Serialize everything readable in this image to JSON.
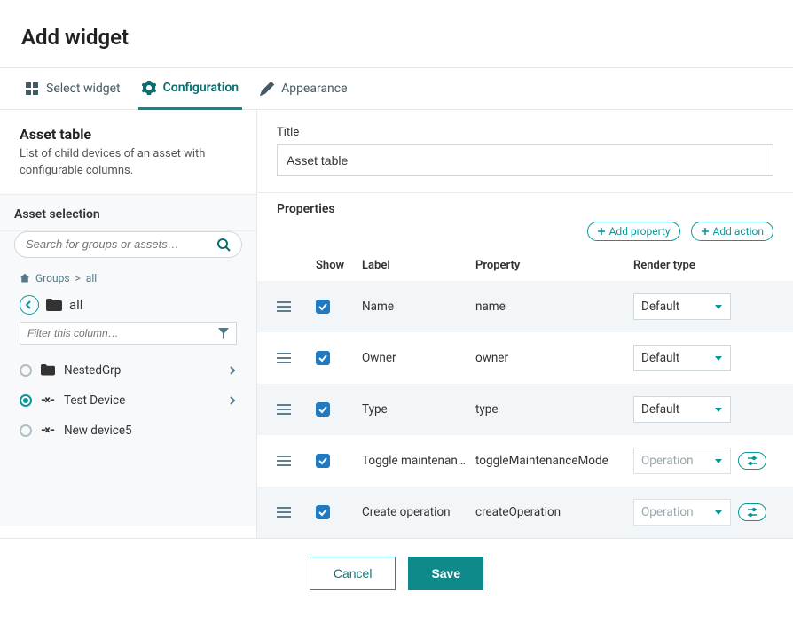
{
  "page_title": "Add widget",
  "tabs": {
    "select": "Select widget",
    "configuration": "Configuration",
    "appearance": "Appearance"
  },
  "desc": {
    "title": "Asset table",
    "text": "List of child devices of an asset with configurable columns."
  },
  "asset_selection": {
    "heading": "Asset selection",
    "search_placeholder": "Search for groups or assets…",
    "breadcrumb_groups": "Groups",
    "breadcrumb_sep": ">",
    "breadcrumb_all": "all",
    "current": "all",
    "filter_placeholder": "Filter this column…",
    "items": [
      {
        "label": "NestedGrp",
        "type": "folder",
        "selected": false,
        "has_children": true
      },
      {
        "label": "Test Device",
        "type": "device",
        "selected": true,
        "has_children": true
      },
      {
        "label": "New device5",
        "type": "device",
        "selected": false,
        "has_children": false
      }
    ]
  },
  "title_field": {
    "label": "Title",
    "value": "Asset table"
  },
  "properties": {
    "heading": "Properties",
    "add_property": "Add property",
    "add_action": "Add action",
    "columns": {
      "show": "Show",
      "label": "Label",
      "property": "Property",
      "render": "Render type"
    },
    "rows": [
      {
        "show": true,
        "label": "Name",
        "property": "name",
        "render": "Default",
        "render_disabled": false,
        "editable": false
      },
      {
        "show": true,
        "label": "Owner",
        "property": "owner",
        "render": "Default",
        "render_disabled": false,
        "editable": false
      },
      {
        "show": true,
        "label": "Type",
        "property": "type",
        "render": "Default",
        "render_disabled": false,
        "editable": false
      },
      {
        "show": true,
        "label": "Toggle maintenance mode",
        "property": "toggleMaintenanceMode",
        "render": "Operation",
        "render_disabled": true,
        "editable": true
      },
      {
        "show": true,
        "label": "Create operation",
        "property": "createOperation",
        "render": "Operation",
        "render_disabled": true,
        "editable": true
      }
    ]
  },
  "footer": {
    "cancel": "Cancel",
    "save": "Save"
  }
}
